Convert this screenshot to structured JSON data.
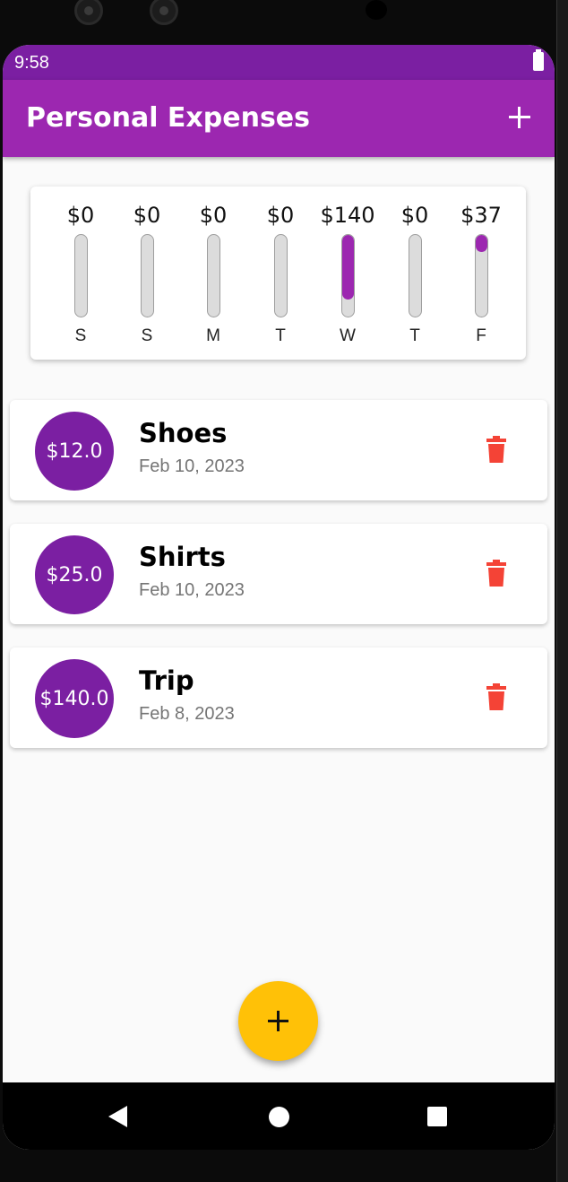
{
  "status_bar": {
    "time": "9:58"
  },
  "app_bar": {
    "title": "Personal Expenses"
  },
  "chart": {
    "days": [
      {
        "label": "S",
        "amount": "$0",
        "fraction": 0.0
      },
      {
        "label": "S",
        "amount": "$0",
        "fraction": 0.0
      },
      {
        "label": "M",
        "amount": "$0",
        "fraction": 0.0
      },
      {
        "label": "T",
        "amount": "$0",
        "fraction": 0.0
      },
      {
        "label": "W",
        "amount": "$140",
        "fraction": 0.79
      },
      {
        "label": "T",
        "amount": "$0",
        "fraction": 0.0
      },
      {
        "label": "F",
        "amount": "$37",
        "fraction": 0.21
      }
    ],
    "accent": "#9c27b0"
  },
  "transactions": [
    {
      "amount": "$12.0",
      "title": "Shoes",
      "date": "Feb 10, 2023"
    },
    {
      "amount": "$25.0",
      "title": "Shirts",
      "date": "Feb 10, 2023"
    },
    {
      "amount": "$140.0",
      "title": "Trip",
      "date": "Feb 8, 2023"
    }
  ],
  "icons": {
    "appbar_add": "plus-icon",
    "delete": "trash-icon",
    "fab": "plus-icon",
    "nav": [
      "back-triangle-icon",
      "home-circle-icon",
      "recents-square-icon"
    ]
  },
  "colors": {
    "primary": "#9c27b0",
    "primary_dark": "#7b1fa2",
    "fab": "#ffc107",
    "delete": "#f44336"
  }
}
